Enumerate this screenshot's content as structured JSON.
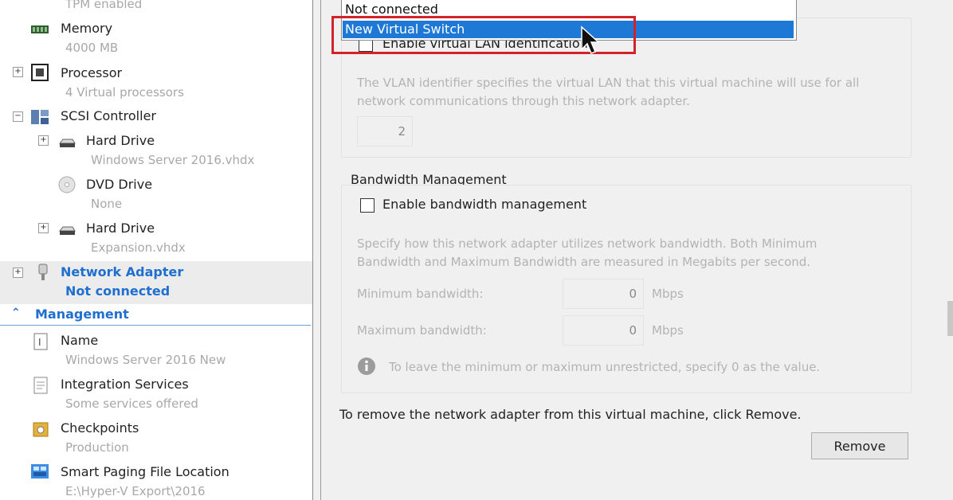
{
  "tree": {
    "tpm": {
      "sub": "TPM enabled"
    },
    "memory": {
      "label": "Memory",
      "sub": "4000 MB"
    },
    "processor": {
      "label": "Processor",
      "sub": "4 Virtual processors",
      "expander": "+"
    },
    "scsi": {
      "label": "SCSI Controller",
      "expander": "−"
    },
    "hard_drive_1": {
      "label": "Hard Drive",
      "sub": "Windows Server 2016.vhdx",
      "expander": "+"
    },
    "dvd_drive": {
      "label": "DVD Drive",
      "sub": "None"
    },
    "hard_drive_2": {
      "label": "Hard Drive",
      "sub": "Expansion.vhdx",
      "expander": "+"
    },
    "network_adapter": {
      "label": "Network Adapter",
      "sub": "Not connected",
      "expander": "+"
    },
    "management_header": {
      "label": "Management",
      "icon": "chevron-up-icon"
    },
    "name": {
      "label": "Name",
      "sub": "Windows Server 2016 New"
    },
    "integration": {
      "label": "Integration Services",
      "sub": "Some services offered"
    },
    "checkpoints": {
      "label": "Checkpoints",
      "sub": "Production"
    },
    "smart_paging": {
      "label": "Smart Paging File Location",
      "sub": "E:\\Hyper-V Export\\2016"
    }
  },
  "switch_dropdown": {
    "options": [
      "Not connected",
      "New Virtual Switch"
    ],
    "highlighted": "New Virtual Switch",
    "highlight_color": "#1e78d6",
    "annotation_color": "#d2232a"
  },
  "vlan": {
    "checkbox_label": "Enable virtual LAN identification",
    "description_line1": "The VLAN identifier specifies the virtual LAN that this virtual machine will use for all",
    "description_line2": "network communications through this network adapter.",
    "identifier": "2"
  },
  "bandwidth": {
    "title": "Bandwidth Management",
    "checkbox_label": "Enable bandwidth management",
    "description_line1": "Specify how this network adapter utilizes network bandwidth. Both Minimum",
    "description_line2": "Bandwidth and Maximum Bandwidth are measured in Megabits per second.",
    "min_label": "Minimum bandwidth:",
    "min_value": "0",
    "max_label": "Maximum bandwidth:",
    "max_value": "0",
    "unit": "Mbps",
    "info_text": "To leave the minimum or maximum unrestricted, specify 0 as the value."
  },
  "remove": {
    "instruction": "To remove the network adapter from this virtual machine, click Remove.",
    "button_label": "Remove"
  }
}
